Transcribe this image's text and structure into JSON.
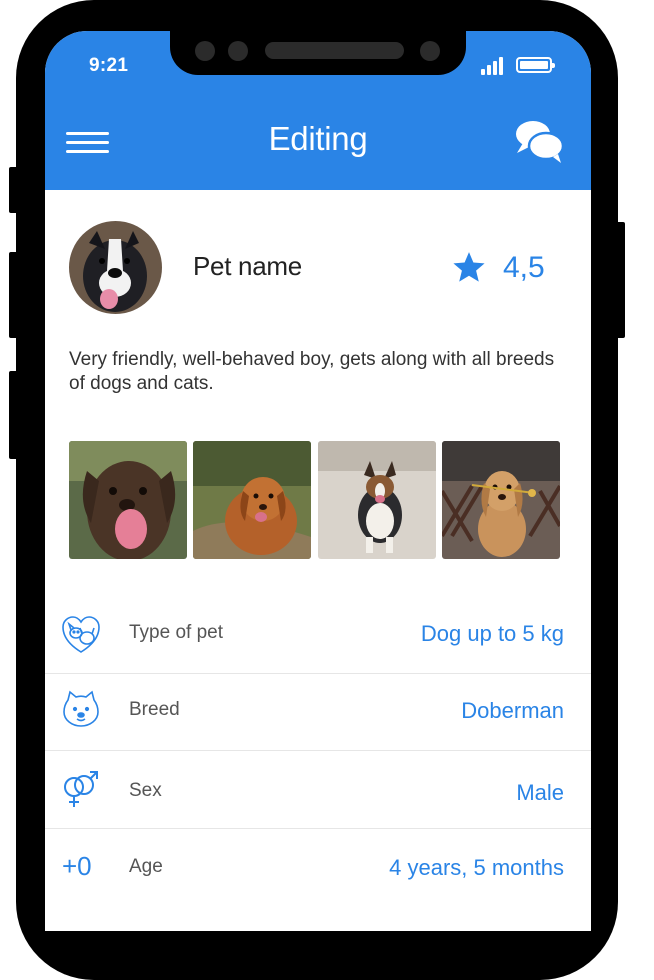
{
  "status_bar": {
    "time": "9:21"
  },
  "header": {
    "title": "Editing",
    "menu_icon": "hamburger-menu-icon",
    "chat_icon": "chat-bubbles-icon"
  },
  "pet": {
    "name": "Pet name",
    "rating": "4,5",
    "description": "Very friendly, well-behaved boy, gets along with all breeds of dogs and cats."
  },
  "details": [
    {
      "label": "Type of pet",
      "value": "Dog up to 5 kg",
      "icon": "pets-icon"
    },
    {
      "label": "Breed",
      "value": "Doberman",
      "icon": "dog-face-icon"
    },
    {
      "label": "Sex",
      "value": "Male",
      "icon": "gender-icon"
    },
    {
      "label": "Age",
      "value": "4 years, 5 months",
      "icon": "age-icon",
      "icon_text": "+0"
    }
  ],
  "colors": {
    "accent": "#2a84e6",
    "text": "#222222",
    "muted": "#555555",
    "divider": "#e6e6e6"
  }
}
